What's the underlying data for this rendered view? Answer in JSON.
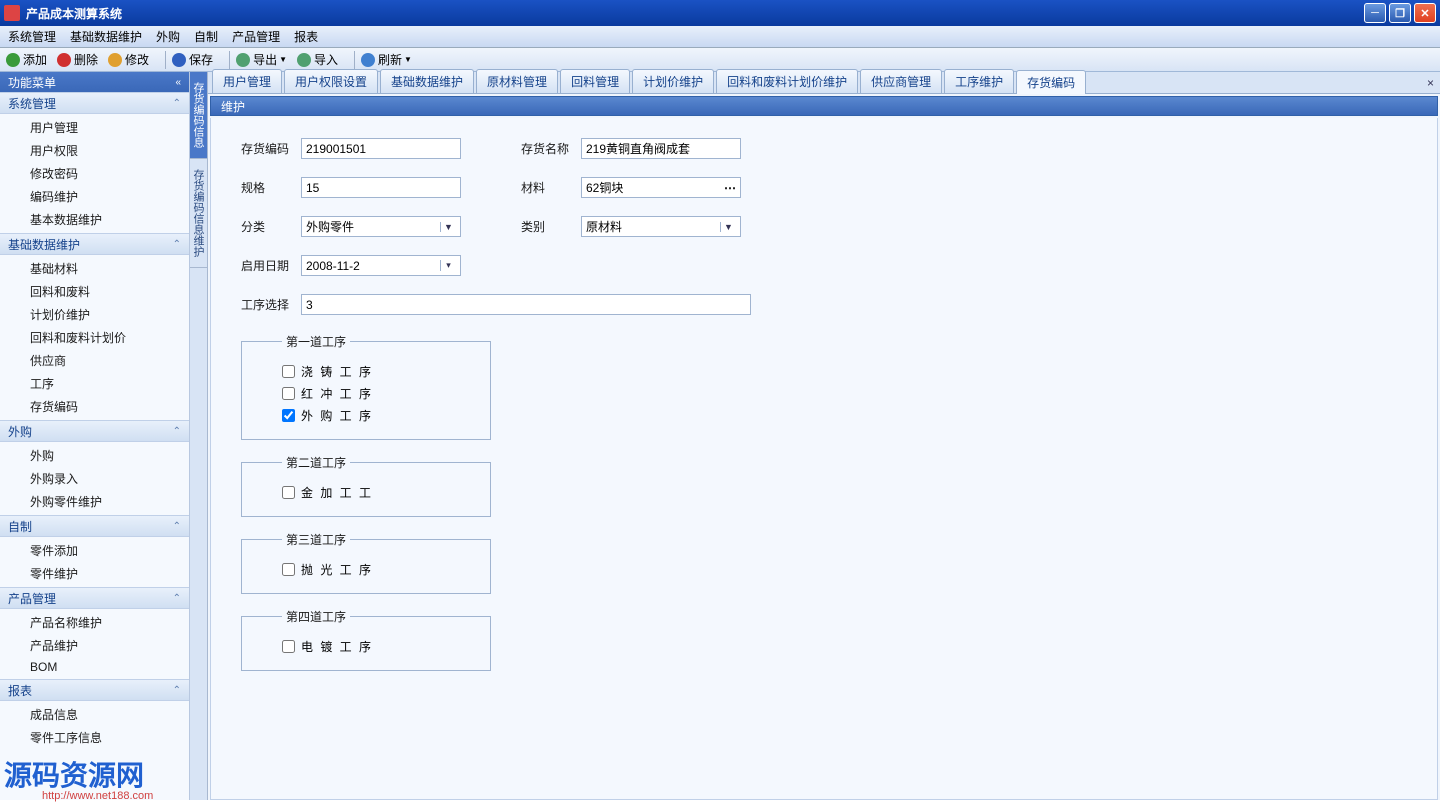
{
  "window": {
    "title": "产品成本测算系统"
  },
  "menubar": [
    "系统管理",
    "基础数据维护",
    "外购",
    "自制",
    "产品管理",
    "报表"
  ],
  "toolbar": {
    "add": "添加",
    "del": "删除",
    "mod": "修改",
    "save": "保存",
    "exp": "导出",
    "imp": "导入",
    "ref": "刷新"
  },
  "sidebar": {
    "title": "功能菜单",
    "groups": [
      {
        "title": "系统管理",
        "items": [
          "用户管理",
          "用户权限",
          "修改密码",
          "编码维护",
          "基本数据维护"
        ]
      },
      {
        "title": "基础数据维护",
        "items": [
          "基础材料",
          "回料和废料",
          "计划价维护",
          "回料和废料计划价",
          "供应商",
          "工序",
          "存货编码"
        ]
      },
      {
        "title": "外购",
        "items": [
          "外购",
          "外购录入",
          "外购零件维护"
        ]
      },
      {
        "title": "自制",
        "items": [
          "零件添加",
          "零件维护"
        ]
      },
      {
        "title": "产品管理",
        "items": [
          "产品名称维护",
          "产品维护",
          "BOM"
        ]
      },
      {
        "title": "报表",
        "items": [
          "成品信息",
          "零件工序信息"
        ]
      }
    ]
  },
  "vtabs": [
    "存货编码信息",
    "存货编码信息维护"
  ],
  "tabs": [
    "用户管理",
    "用户权限设置",
    "基础数据维护",
    "原材料管理",
    "回料管理",
    "计划价维护",
    "回料和废料计划价维护",
    "供应商管理",
    "工序维护",
    "存货编码"
  ],
  "panel": {
    "title": "维护"
  },
  "form": {
    "code_lbl": "存货编码",
    "code": "219001501",
    "name_lbl": "存货名称",
    "name": "219黄铜直角阀成套",
    "spec_lbl": "规格",
    "spec": "15",
    "mat_lbl": "材料",
    "mat": "62铜块",
    "cat_lbl": "分类",
    "cat": "外购零件",
    "type_lbl": "类别",
    "type": "原材料",
    "date_lbl": "启用日期",
    "date": "2008-11-2",
    "proc_lbl": "工序选择",
    "proc": "3"
  },
  "procs": {
    "g1": {
      "legend": "第一道工序",
      "items": [
        {
          "label": "浇 铸 工 序",
          "chk": false
        },
        {
          "label": "红 冲 工 序",
          "chk": false
        },
        {
          "label": "外 购 工 序",
          "chk": true
        }
      ]
    },
    "g2": {
      "legend": "第二道工序",
      "items": [
        {
          "label": "金 加 工 工",
          "chk": false
        }
      ]
    },
    "g3": {
      "legend": "第三道工序",
      "items": [
        {
          "label": "抛 光  工 序",
          "chk": false
        }
      ]
    },
    "g4": {
      "legend": "第四道工序",
      "items": [
        {
          "label": "电 镀  工 序",
          "chk": false
        }
      ]
    }
  },
  "watermark": {
    "text": "源码资源网",
    "url": "http://www.net188.com"
  }
}
